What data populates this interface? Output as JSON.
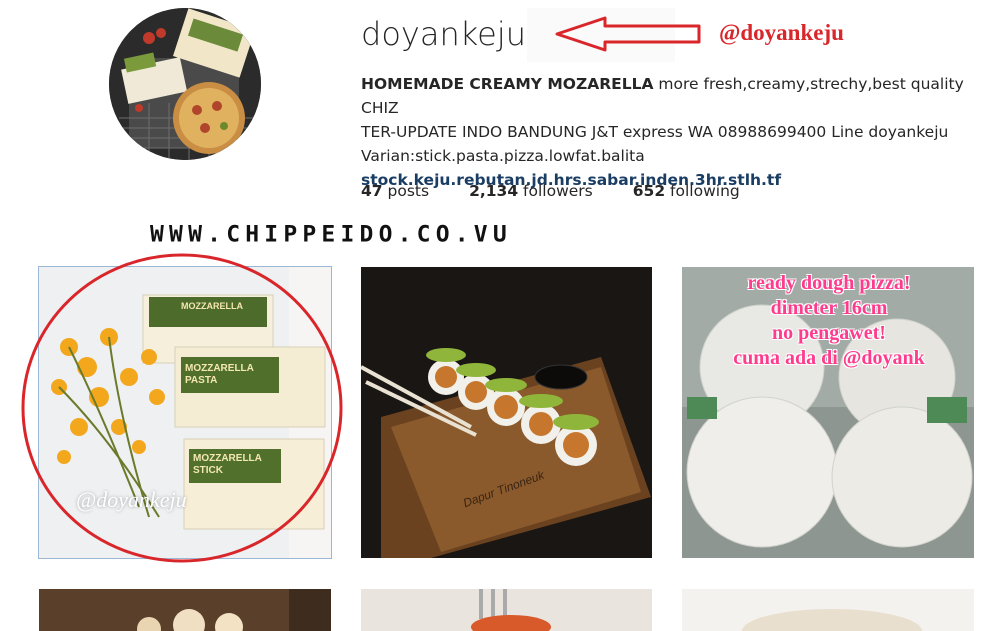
{
  "profile": {
    "username": "doyankeju",
    "annotation_handle": "@doyankeju",
    "bio_title": "HOMEMADE CREAMY MOZARELLA",
    "bio_line1_rest": "more fresh,creamy,strechy,best quality CHIZ",
    "bio_line2": "TER-UPDATE INDO BANDUNG J&T express WA 08988699400 Line doyankeju",
    "bio_line3": "Varian:stick.pasta.pizza.lowfat.balita",
    "bio_link": "stock.keju.rebutan.jd.hrs.sabar.inden.3hr.stlh.tf"
  },
  "stats": {
    "posts_count": "47",
    "posts_label": "posts",
    "followers_count": "2,134",
    "followers_label": "followers",
    "following_count": "652",
    "following_label": "following"
  },
  "watermark": "WWW.CHIPPEIDO.CO.VU",
  "posts": [
    {
      "caption_overlay": "@doyankeju",
      "label_1": "MOZZARELLA",
      "label_2": "MOZZARELLA PASTA",
      "label_3": "MOZZARELLA STICK"
    },
    {
      "board_text": "Dapur Tinoneuk"
    },
    {
      "overlay_lines": [
        "ready dough pizza!",
        "dimeter 16cm",
        "no pengawet!",
        "cuma ada di @doyank"
      ]
    }
  ],
  "colors": {
    "annotation_red": "#d9262b",
    "link_blue": "#1a3d64",
    "pizza_text_pink": "#ff3b8e"
  }
}
